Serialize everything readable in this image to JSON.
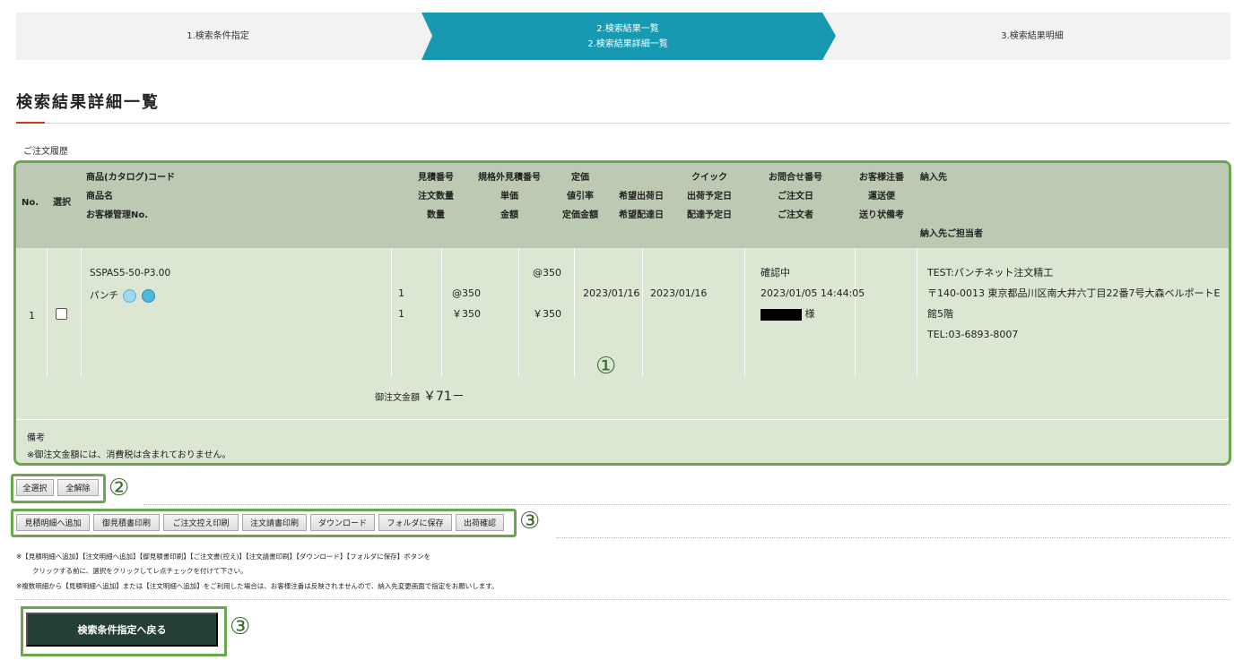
{
  "steps": {
    "step1": "1.検索条件指定",
    "step2_line1": "2.検索結果一覧",
    "step2_line2": "2.検索結果詳細一覧",
    "step3": "3.検索結果明細"
  },
  "page_title": "検索結果詳細一覧",
  "section_label": "ご注文履歴",
  "table": {
    "headers": {
      "no": "No.",
      "select": "選択",
      "product": [
        "商品(カタログ)コード",
        "商品名",
        "お客様管理No."
      ],
      "quote": [
        "見積番号",
        "注文数量",
        "数量"
      ],
      "nonstd": [
        "規格外見積番号",
        "単価",
        "金額"
      ],
      "price": [
        "定価",
        "値引率",
        "定価金額"
      ],
      "dates": [
        "希望出荷日",
        "希望配達日"
      ],
      "quick": [
        "クイック",
        "出荷予定日",
        "配達予定日"
      ],
      "inquiry": [
        "お問合せ番号",
        "ご注文日",
        "ご注文者"
      ],
      "customer": [
        "お客様注番",
        "運送便",
        "送り状備考"
      ],
      "delivery": [
        "納入先",
        "納入先ご担当者"
      ]
    },
    "row": {
      "no": "1",
      "code": "SSPAS5-50-P3.00",
      "name": "パンチ",
      "qty_order": "1",
      "qty": "1",
      "unit_price": "@350",
      "amount": "￥350",
      "list_price": "@350",
      "list_amount": "￥350",
      "ship_date": "2023/01/16",
      "delivery_date": "2023/01/16",
      "status": "確認中",
      "order_date": "2023/01/05 14:44:05",
      "orderer_suffix": "様",
      "delivery_name": "TEST:パンチネット注文精工",
      "delivery_address": "〒140-0013 東京都品川区南大井六丁目22番7号大森ベルポートE館5階",
      "delivery_tel": "TEL:03-6893-8007"
    },
    "total_label": "御注文金額",
    "total_amount": "￥71－",
    "notes_label": "備考",
    "notes_text": "※御注文金額には、消費税は含まれておりません。"
  },
  "annotations": {
    "one": "①",
    "two": "②",
    "three": "③"
  },
  "select_buttons": {
    "select_all": "全選択",
    "deselect_all": "全解除"
  },
  "action_buttons": {
    "add_quote": "見積明細へ追加",
    "print_quote": "御見積書印刷",
    "print_order_copy": "ご注文控え印刷",
    "print_order_form": "注文請書印刷",
    "download": "ダウンロード",
    "save_folder": "フォルダに保存",
    "ship_confirm": "出荷確認"
  },
  "footnotes": {
    "line1": "※【見積明細へ追加】【注文明細へ追加】【御見積書印刷】【ご注文書(控え)】【注文請書印刷】【ダウンロード】【フォルダに保存】ボタンを",
    "line2": "クリックする前に、選択をクリックしてレ点チェックを付けて下さい。",
    "line3": "※複数明細から【見積明細へ追加】または【注文明細へ追加】をご利用した場合は、お客様注番は反映されませんので、納入先変更画面で指定をお願いします。"
  },
  "back_button": "検索条件指定へ戻る",
  "colors": {
    "accent_step": "#1799b1",
    "highlight_border": "#6aa84f",
    "back_button_bg": "#243f33",
    "title_accent": "#c73a1e"
  }
}
